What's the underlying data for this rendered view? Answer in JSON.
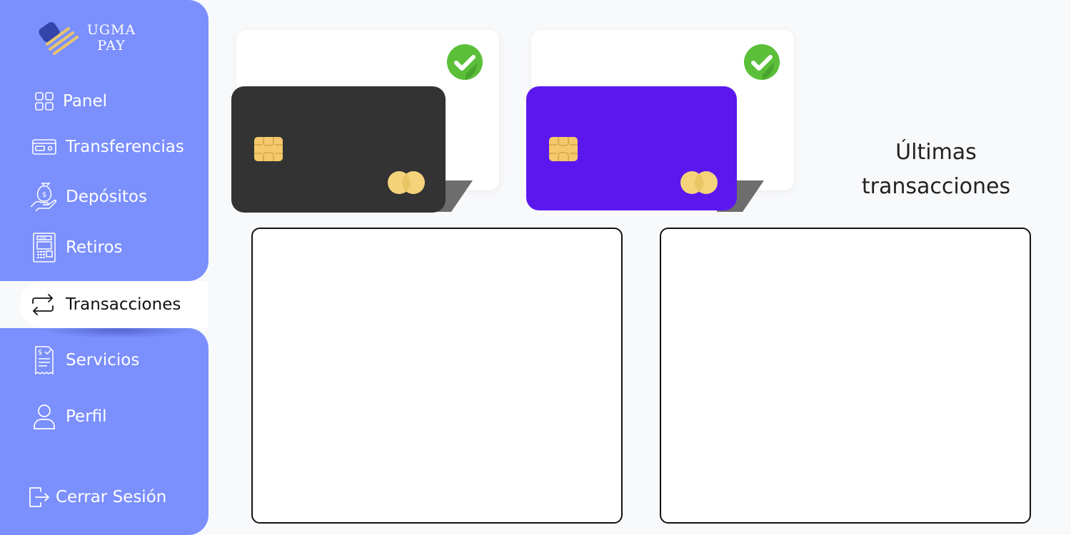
{
  "brand": {
    "line1": "UGMA",
    "line2": "PAY"
  },
  "sidebar": {
    "items": [
      {
        "label": "Panel",
        "icon": "grid-icon"
      },
      {
        "label": "Transferencias",
        "icon": "card-icon"
      },
      {
        "label": "Depósitos",
        "icon": "money-bag-hand-icon"
      },
      {
        "label": "Retiros",
        "icon": "atm-icon"
      },
      {
        "label": "Transacciones",
        "icon": "swap-arrows-icon",
        "active": true
      },
      {
        "label": "Servicios",
        "icon": "bill-icon"
      },
      {
        "label": "Perfil",
        "icon": "user-icon"
      }
    ],
    "logout": {
      "label": "Cerrar Sesión",
      "icon": "logout-icon"
    }
  },
  "cards": [
    {
      "color": "#333333",
      "status": "selected"
    },
    {
      "color": "#5c17ee",
      "status": "selected"
    }
  ],
  "recent": {
    "title_line1": "Últimas",
    "title_line2": "transacciones"
  },
  "colors": {
    "sidebar": "#7b8ffd",
    "check": "#5bbf3a",
    "chip": "#f5c96b",
    "mastercard": "#f4d37b"
  }
}
